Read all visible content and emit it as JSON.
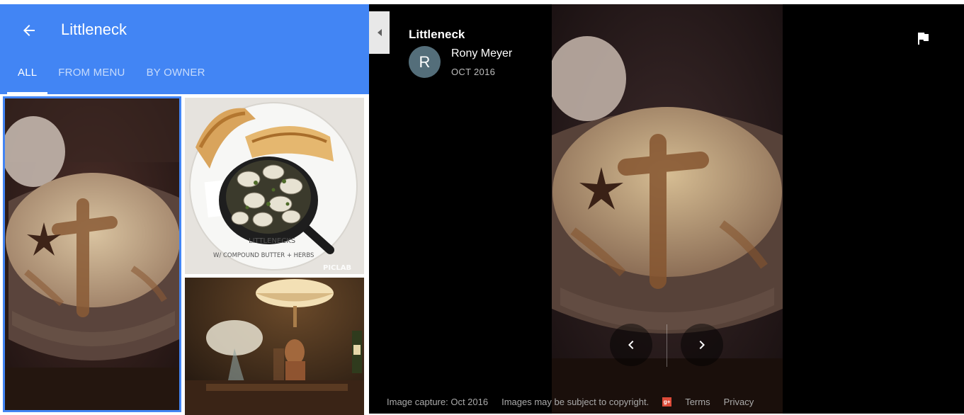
{
  "panel": {
    "title": "Littleneck",
    "back_icon": "arrow-left-icon",
    "tabs": [
      {
        "label": "ALL",
        "active": true
      },
      {
        "label": "FROM MENU",
        "active": false
      },
      {
        "label": "BY OWNER",
        "active": false
      }
    ],
    "accent_color": "#4285f4"
  },
  "gallery": {
    "photos": [
      {
        "subject": "cocktail with star anise and cinnamon cross",
        "selected": true
      },
      {
        "subject": "littleneck clams in cast iron skillet with bread",
        "caption_lines": [
          "LITTLENECKS",
          "W/ COMPOUND BUTTER + HERBS"
        ],
        "watermark": "PICLAB"
      },
      {
        "subject": "bar interior with fisherman statue lamp and flowers"
      }
    ]
  },
  "viewer": {
    "title": "Littleneck",
    "author": "Rony Meyer",
    "avatar_letter": "R",
    "date": "OCT 2016",
    "flag_icon": "flag-icon",
    "collapse_icon": "caret-left-icon",
    "prev_icon": "chevron-left-icon",
    "next_icon": "chevron-right-icon"
  },
  "footer": {
    "capture": "Image capture: Oct 2016",
    "copyright": "Images may be subject to copyright.",
    "gplus": "g+",
    "terms": "Terms",
    "privacy": "Privacy"
  }
}
